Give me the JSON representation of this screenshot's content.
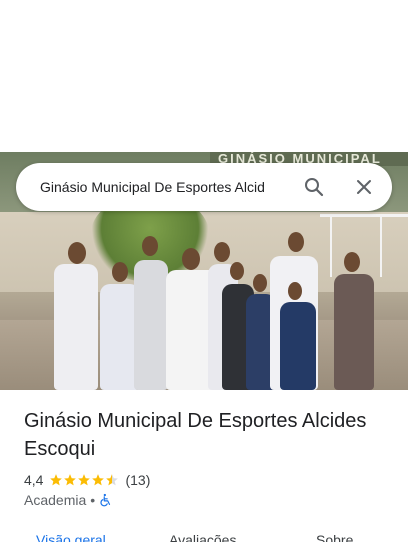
{
  "search": {
    "query": "Ginásio Municipal De Esportes Alcid"
  },
  "photo": {
    "sign_text": "GINÁSIO MUNICIPAL"
  },
  "place": {
    "title": "Ginásio Municipal De Esportes Alcides Escoqui",
    "rating": "4,4",
    "rating_value": 4.4,
    "review_count": "(13)",
    "category": "Academia",
    "separator": "•",
    "accessibility_icon": "wheelchair-icon"
  },
  "tabs": [
    {
      "label": "Visão geral",
      "active": true
    },
    {
      "label": "Avaliações",
      "active": false
    },
    {
      "label": "Sobre",
      "active": false
    }
  ],
  "colors": {
    "accent": "#1a73e8",
    "star": "#fbbc04",
    "wheelchair": "#1a73e8"
  }
}
